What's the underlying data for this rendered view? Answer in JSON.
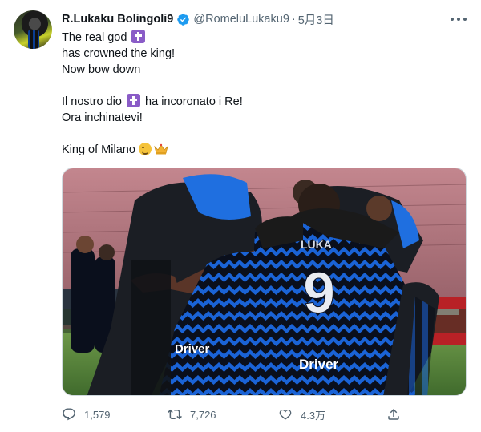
{
  "tweet": {
    "author_name": "R.Lukaku Bolingoli9",
    "handle": "@RomeluLukaku9",
    "separator": "·",
    "date": "5月3日",
    "lines": {
      "l1_text": "The real god",
      "l2": "has crowned the king!",
      "l3": "Now bow down",
      "l4_pre": "Il nostro dio",
      "l4_post": "ha incoronato i Re!",
      "l5": "Ora inchinatevi!",
      "l6": "King of Milano"
    },
    "image": {
      "shirt_number": "9",
      "sponsor": "Driver",
      "back_name": "LUKA"
    },
    "stats": {
      "replies": "1,579",
      "retweets": "7,726",
      "likes": "4.3万"
    }
  },
  "icons": {
    "verified": "verified-badge-icon",
    "more": "more-options-icon",
    "reply": "reply-icon",
    "retweet": "retweet-icon",
    "like": "heart-icon",
    "share": "share-icon"
  },
  "colors": {
    "verified": "#1d9bf0",
    "secondary_text": "#536471",
    "inter_blue": "#0a5bd3",
    "inter_black": "#111111"
  }
}
